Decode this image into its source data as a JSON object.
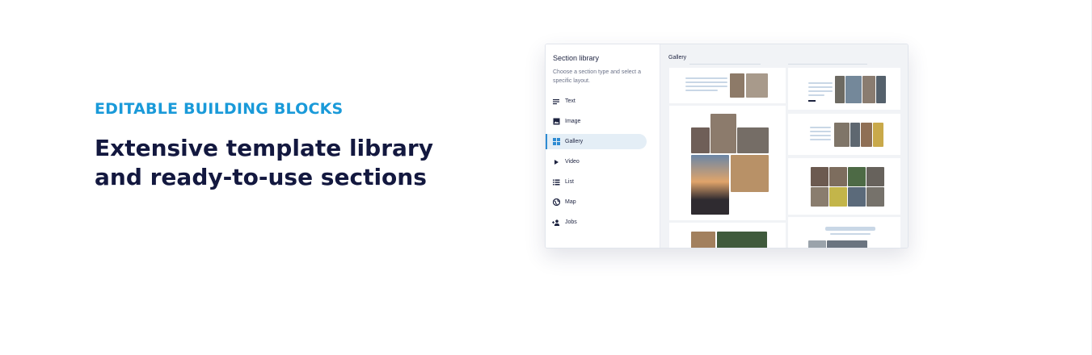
{
  "hero": {
    "eyebrow": "EDITABLE BUILDING BLOCKS",
    "headline": "Extensive template library and ready-to-use sections"
  },
  "section_library": {
    "title": "Section library",
    "description": "Choose a section type and select a specific layout.",
    "items": [
      {
        "label": "Text",
        "icon": "text-lines-icon"
      },
      {
        "label": "Image",
        "icon": "image-icon"
      },
      {
        "label": "Gallery",
        "icon": "grid-icon",
        "active": true
      },
      {
        "label": "Video",
        "icon": "play-icon"
      },
      {
        "label": "List",
        "icon": "list-icon"
      },
      {
        "label": "Map",
        "icon": "globe-icon"
      },
      {
        "label": "Jobs",
        "icon": "person-add-icon"
      }
    ]
  },
  "gallery": {
    "title": "Gallery"
  },
  "colors": {
    "eyebrow": "#1a9ad9",
    "headline": "#13183f",
    "active_item_bg": "#e4eef6",
    "active_item_bar": "#2e8bd2"
  }
}
